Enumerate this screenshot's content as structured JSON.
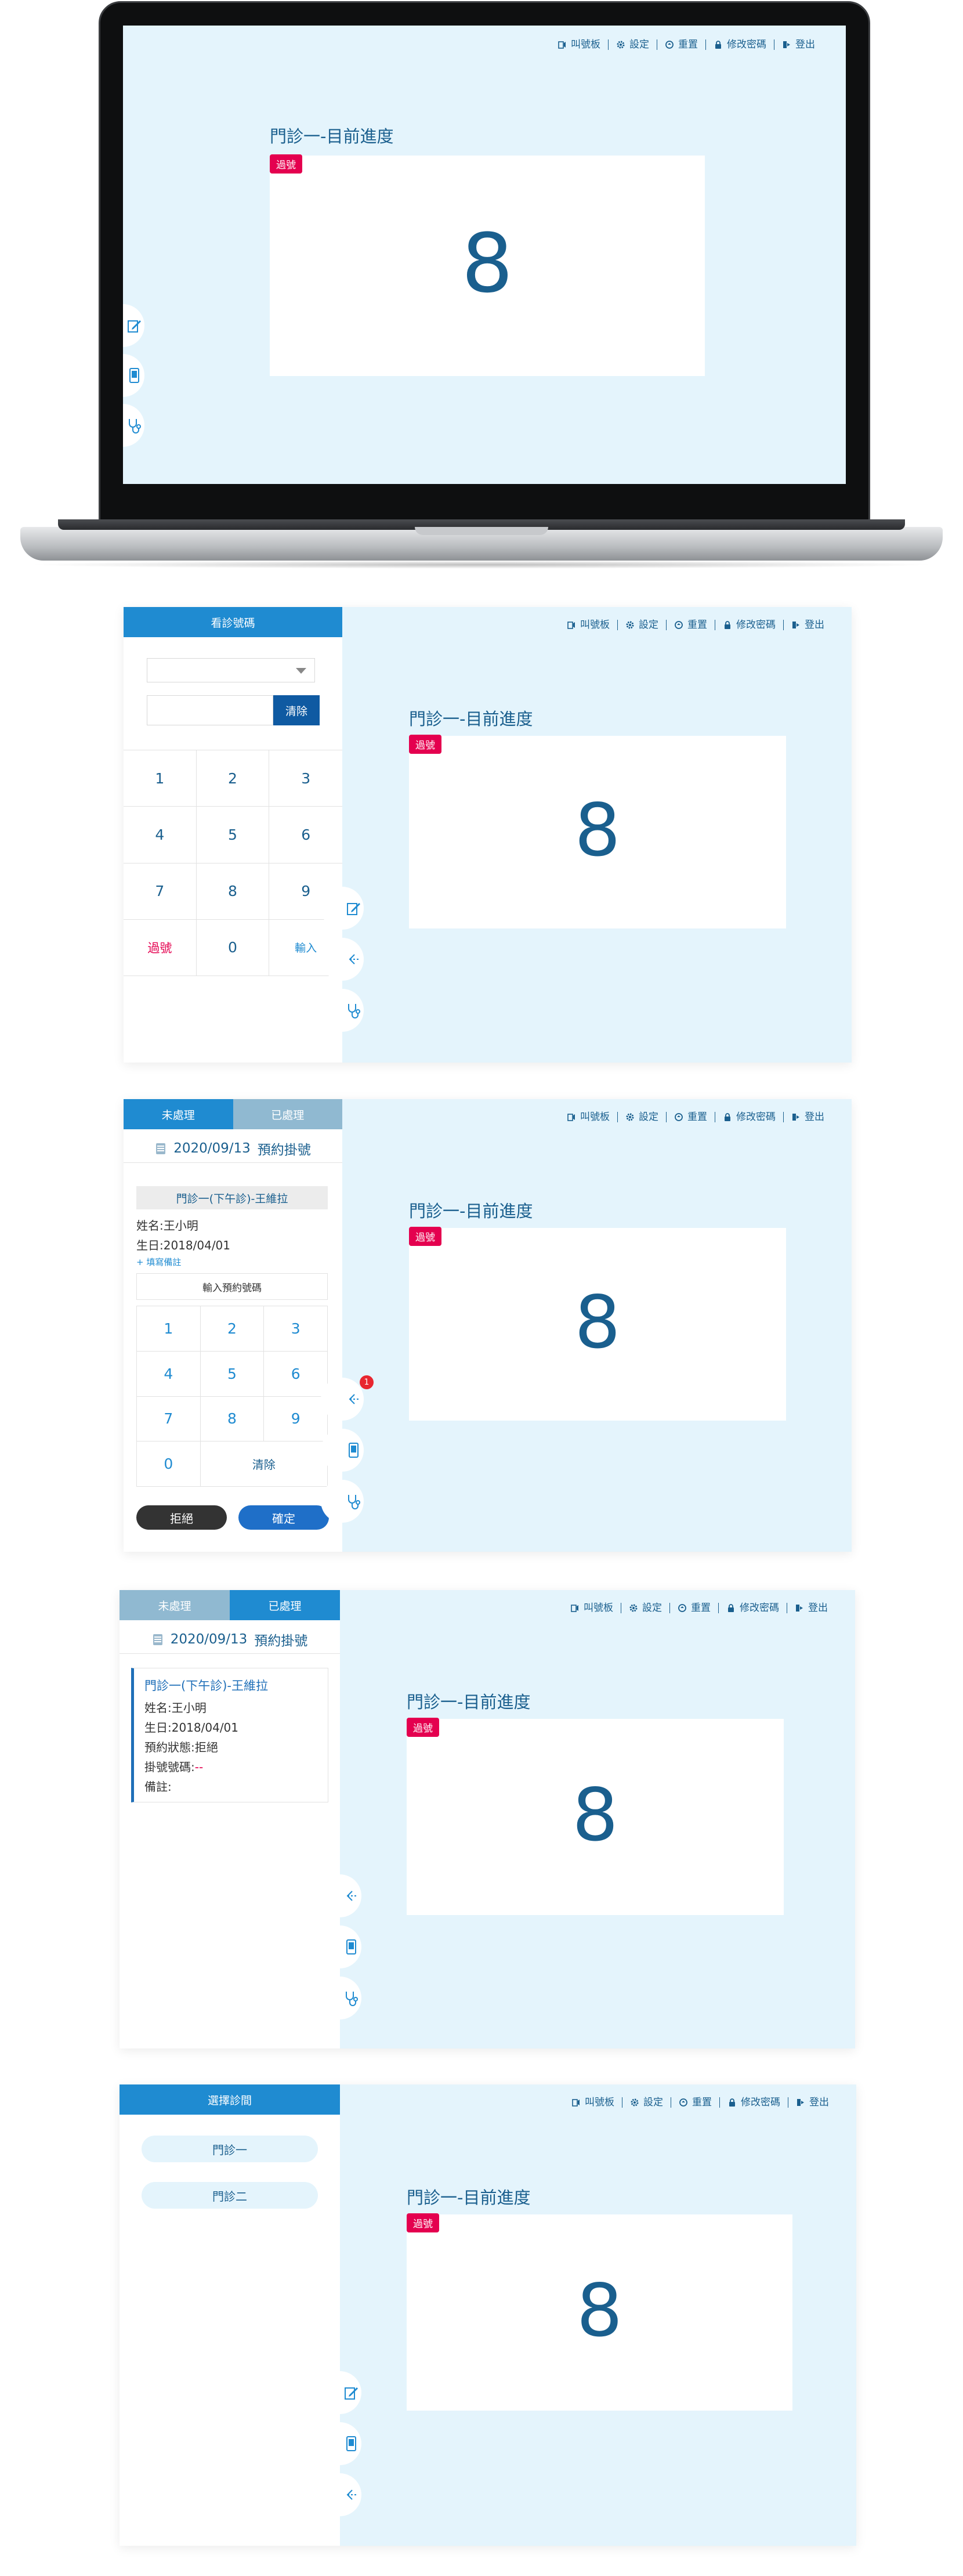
{
  "menu": {
    "call_board": "叫號板",
    "settings": "設定",
    "reset": "重置",
    "change_password": "修改密碼",
    "logout": "登出"
  },
  "progress": {
    "title": "門診一-目前進度",
    "badge": "過號",
    "number": "8"
  },
  "keypad_panel": {
    "header": "看診號碼",
    "clear": "清除",
    "keys": [
      "1",
      "2",
      "3",
      "4",
      "5",
      "6",
      "7",
      "8",
      "9",
      "過號",
      "0",
      "輸入"
    ]
  },
  "pending_panel": {
    "tabs": [
      "未處理",
      "已處理"
    ],
    "date": "2020/09/13",
    "date_title": "預約掛號",
    "clinic_label": "門診一(下午診)-王維拉",
    "name": "姓名:王小明",
    "birthday": "生日:2018/04/01",
    "add_note": "+ 填寫備註",
    "appt_input": "輸入預約號碼",
    "keys": [
      "1",
      "2",
      "3",
      "4",
      "5",
      "6",
      "7",
      "8",
      "9",
      "0",
      "清除"
    ],
    "reject": "拒絕",
    "confirm": "確定",
    "notify_count": "1"
  },
  "processed_panel": {
    "tabs": [
      "未處理",
      "已處理"
    ],
    "date": "2020/09/13",
    "date_title": "預約掛號",
    "record": {
      "title": "門診一(下午診)-王維拉",
      "name": "姓名:王小明",
      "birthday": "生日:2018/04/01",
      "status": "預約狀態:拒絕",
      "number_label": "掛號號碼:",
      "number_value": "--",
      "note": "備註:"
    }
  },
  "clinic_panel": {
    "header": "選擇診間",
    "clinics": [
      "門診一",
      "門診二"
    ]
  },
  "colors": {
    "primary": "#1f8bd1",
    "dark_blue": "#1a5f8e",
    "badge_red": "#e4004f",
    "bg_light": "#e4f4fc"
  }
}
